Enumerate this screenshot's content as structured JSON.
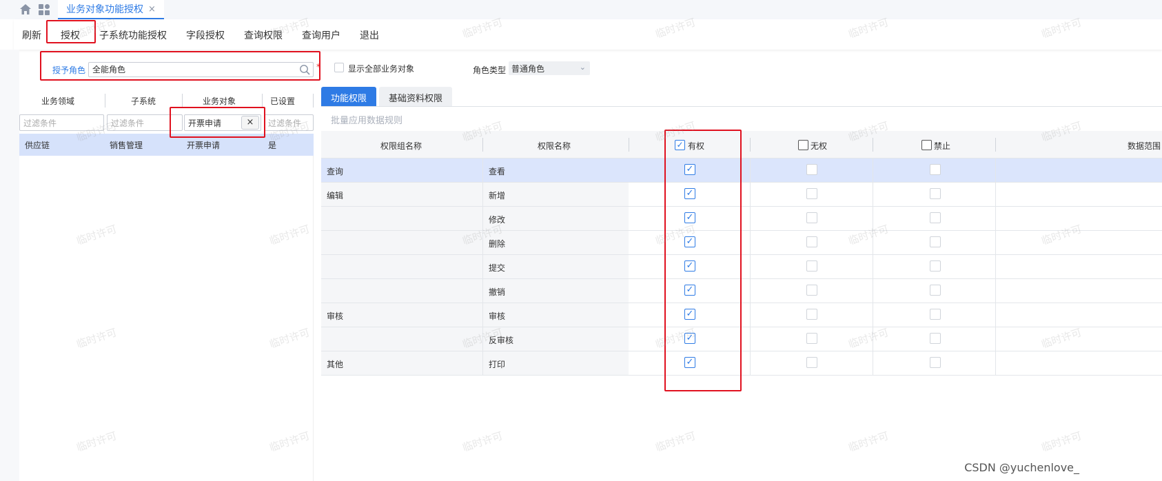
{
  "app": {
    "tab_title": "业务对象功能授权",
    "tab_close": "×"
  },
  "toolbar": {
    "items": [
      "刷新",
      "授权",
      "子系统功能授权",
      "字段授权",
      "查询权限",
      "查询用户",
      "退出"
    ]
  },
  "role": {
    "label": "授予角色",
    "value": "全能角色",
    "required": "*"
  },
  "show_all": {
    "label": "显示全部业务对象",
    "checked": false
  },
  "role_type": {
    "label": "角色类型",
    "value": "普通角色"
  },
  "left_table": {
    "columns": [
      "业务领域",
      "子系统",
      "业务对象",
      "已设置"
    ],
    "filters": [
      {
        "placeholder": "过滤条件",
        "value": ""
      },
      {
        "placeholder": "过滤条件",
        "value": ""
      },
      {
        "placeholder": "过滤条件",
        "value": "开票申请"
      },
      {
        "placeholder": "过滤条件",
        "value": ""
      }
    ],
    "filter_clear": "×",
    "rows": [
      [
        "供应链",
        "销售管理",
        "开票申请",
        "是"
      ]
    ]
  },
  "right_tabs": [
    "功能权限",
    "基础资料权限"
  ],
  "batch_apply": "批量应用数据规则",
  "grid": {
    "columns": {
      "group": "权限组名称",
      "perm": "权限名称",
      "has": "有权",
      "none": "无权",
      "deny": "禁止",
      "range": "数据范围"
    },
    "header_has_checked": true,
    "rows": [
      {
        "group": "查询",
        "perm": "查看",
        "has": true,
        "selected": true
      },
      {
        "group": "编辑",
        "perm": "新增",
        "has": true
      },
      {
        "group": "",
        "perm": "修改",
        "has": true
      },
      {
        "group": "",
        "perm": "删除",
        "has": true
      },
      {
        "group": "",
        "perm": "提交",
        "has": true
      },
      {
        "group": "",
        "perm": "撤销",
        "has": true
      },
      {
        "group": "审核",
        "perm": "审核",
        "has": true
      },
      {
        "group": "",
        "perm": "反审核",
        "has": true
      },
      {
        "group": "其他",
        "perm": "打印",
        "has": true
      }
    ]
  },
  "watermark": "临时许可",
  "credit": "CSDN @yuchenlove_",
  "colors": {
    "accent": "#2e7be5",
    "annotation": "#e0101e",
    "selected_row": "#d6e2fb"
  }
}
